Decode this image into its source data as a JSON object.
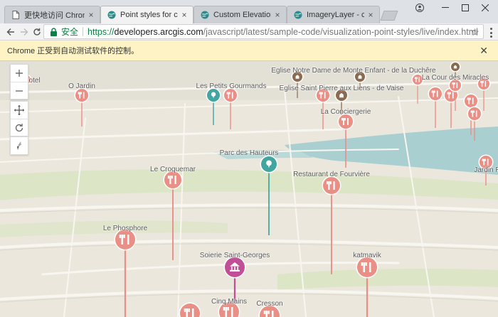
{
  "tabs": [
    {
      "title": "更快地访问 Chromium",
      "icon": "page-icon",
      "active": false
    },
    {
      "title": "Point styles for cities - ",
      "icon": "arcgis-globe-icon",
      "active": true
    },
    {
      "title": "Custom ElevationLayer",
      "icon": "arcgis-globe-icon",
      "active": false
    },
    {
      "title": "ImageryLayer - client s",
      "icon": "arcgis-globe-icon",
      "active": false
    }
  ],
  "toolbar": {
    "secure_label": "安全",
    "url_scheme": "https://",
    "url_host": "developers.arcgis.com",
    "url_path": "/javascript/latest/sample-code/visualization-point-styles/live/index.html"
  },
  "infobar": {
    "message": "Chrome 正受到自动测试软件的控制。"
  },
  "map": {
    "widgets": [
      "zoom-in",
      "zoom-out",
      "pan",
      "rotate",
      "compass"
    ],
    "pois": [
      {
        "label": "Eglise Notre Dame de Monte Enfant - de la Duchêre",
        "icon": "church-icon"
      },
      {
        "label": "La Cour des Miracles",
        "icon": "restaurant-icon"
      },
      {
        "label": "O Jardin",
        "icon": "restaurant-icon"
      },
      {
        "label": "Les Petits Gourmands",
        "icon": "restaurant-icon"
      },
      {
        "label": "Eglise Saint Pierre aux Liens - de Vaise",
        "icon": "church-icon"
      },
      {
        "label": "La Conciergerie",
        "icon": "restaurant-icon"
      },
      {
        "label": "Parc des Hauteurs",
        "icon": "park-icon"
      },
      {
        "label": "Le Croquemar",
        "icon": "restaurant-icon"
      },
      {
        "label": "Restaurant de Fourvière",
        "icon": "restaurant-icon"
      },
      {
        "label": "Jardin R",
        "icon": "restaurant-icon"
      },
      {
        "label": "Le Phosphore",
        "icon": "restaurant-icon"
      },
      {
        "label": "Soierie Saint-Georges",
        "icon": "museum-icon"
      },
      {
        "label": "katmavik",
        "icon": "restaurant-icon"
      },
      {
        "label": "Cinq Mains",
        "icon": "restaurant-icon"
      },
      {
        "label": "Cresson",
        "icon": "restaurant-icon"
      },
      {
        "label": "Hotel",
        "icon": "hotel-icon"
      }
    ]
  },
  "colors": {
    "restaurant_pin": "#ea8f86",
    "park_pin": "#42a6a0",
    "museum_pin": "#c04f97",
    "church_pin": "#8c6a4f",
    "water": "#a9cfd1",
    "land": "#ebe7dc",
    "green": "#dde5c7"
  }
}
